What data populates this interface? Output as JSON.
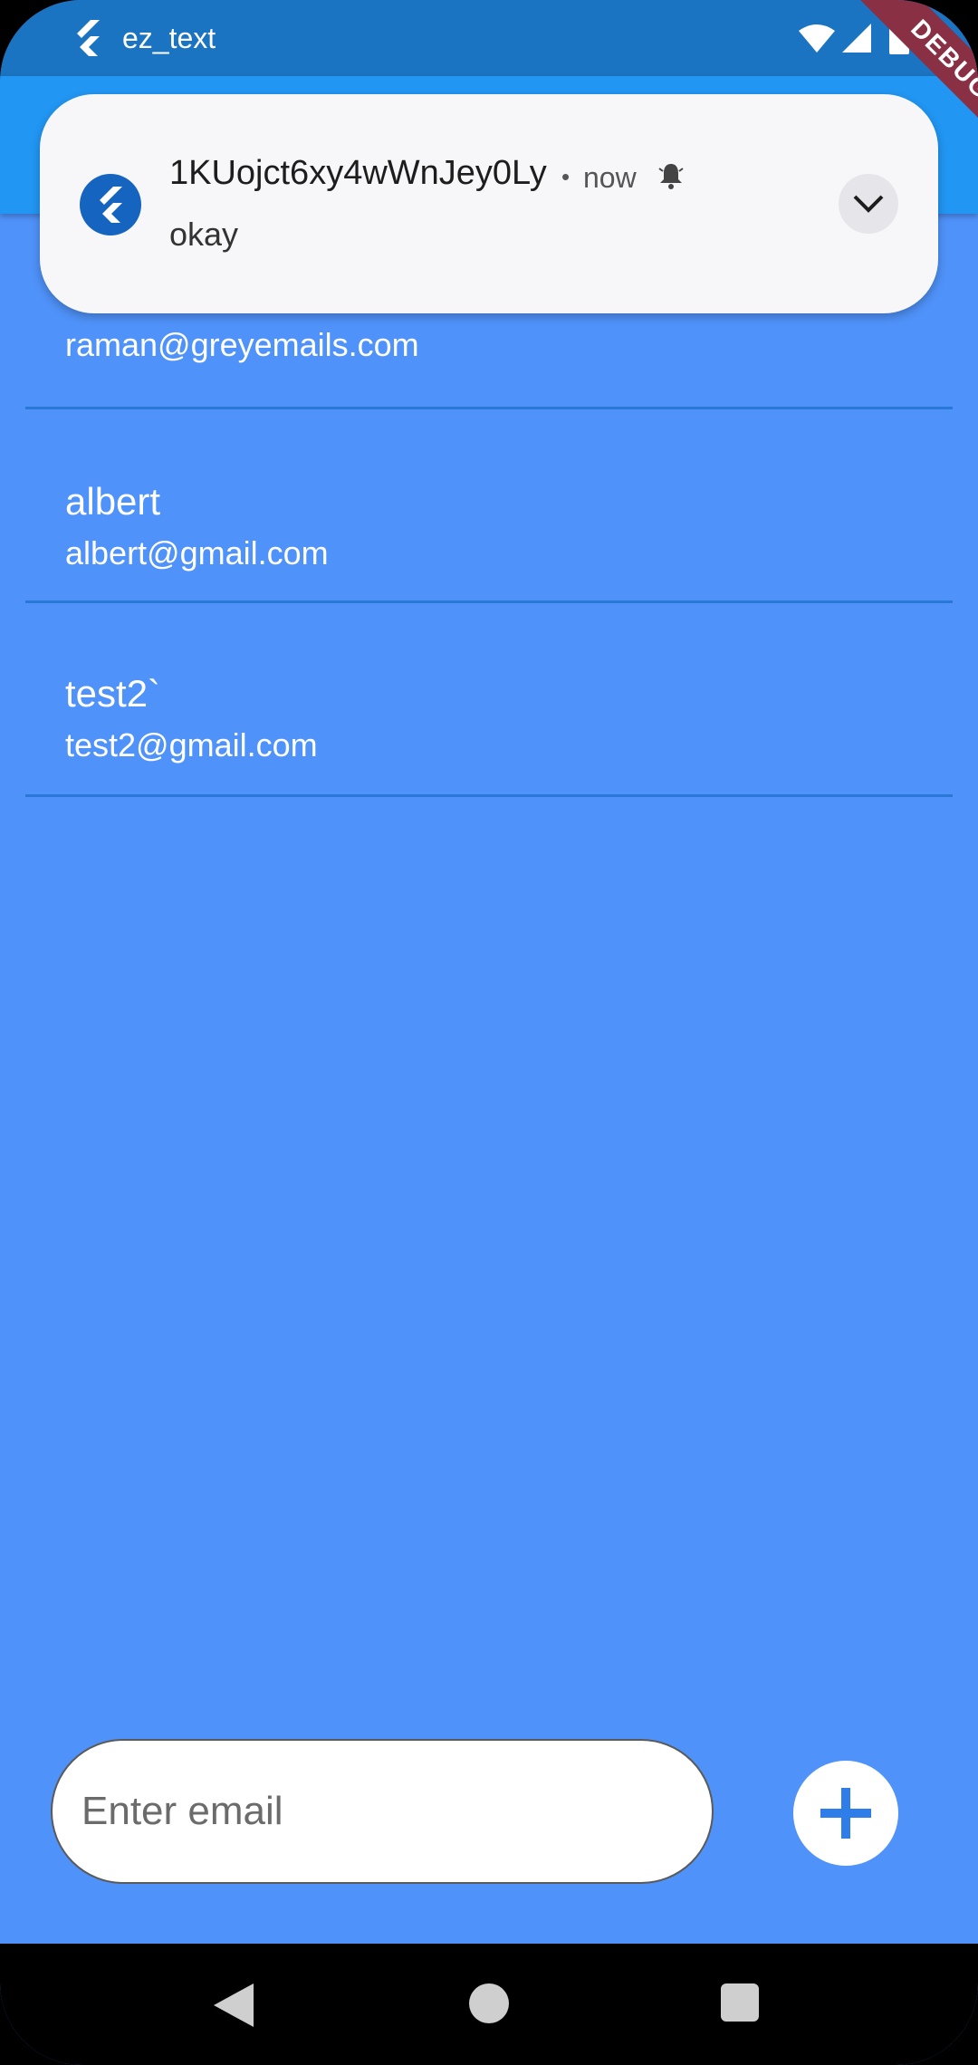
{
  "status_bar": {
    "app_label": "ez_text",
    "icons": [
      "flutter-logo-icon",
      "wifi-icon",
      "signal-icon",
      "battery-icon"
    ]
  },
  "debug_banner": "DEBUG",
  "notification": {
    "title": "1KUojct6xy4wWnJey0Ly",
    "separator": "•",
    "time": "now",
    "message": "okay",
    "icons": [
      "flutter-app-icon",
      "bell-icon",
      "chevron-down-icon"
    ]
  },
  "contacts": [
    {
      "name": "",
      "email": "raman@greyemails.com"
    },
    {
      "name": "albert",
      "email": "albert@gmail.com"
    },
    {
      "name": "test2`",
      "email": "test2@gmail.com"
    }
  ],
  "input": {
    "placeholder": "Enter email",
    "value": ""
  },
  "add_button_icon": "plus-icon",
  "nav_bar": {
    "icons": [
      "back-icon",
      "home-icon",
      "recents-icon"
    ]
  },
  "colors": {
    "background": "#4f92f9",
    "status_bar": "#1b74c1",
    "app_bar": "#2196f3",
    "divider": "#2a78d6",
    "accent": "#2f7de8",
    "debug_ribbon": "#8a3045"
  }
}
